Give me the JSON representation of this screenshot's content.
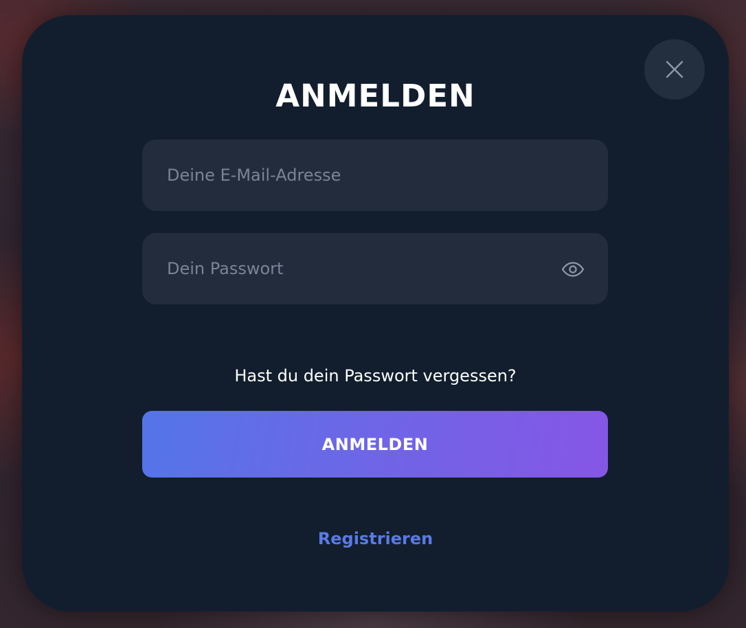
{
  "modal": {
    "title": "ANMELDEN",
    "close_icon": "close-icon"
  },
  "form": {
    "email": {
      "value": "",
      "placeholder": "Deine E-Mail-Adresse"
    },
    "password": {
      "value": "",
      "placeholder": "Dein Passwort",
      "toggle_icon": "eye-icon"
    },
    "forgot_password_label": "Hast du dein Passwort vergessen?",
    "submit_label": "ANMELDEN",
    "register_label": "Registrieren"
  },
  "colors": {
    "modal_background": "#121e2d",
    "field_background": "#222c3c",
    "placeholder_text": "#7a8495",
    "button_gradient_start": "#5475e8",
    "button_gradient_end": "#8656e6",
    "link_accent": "#5a7ae6",
    "close_button_background": "#232f3f"
  }
}
